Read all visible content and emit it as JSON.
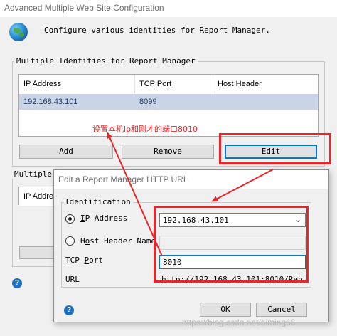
{
  "main_window": {
    "title": "Advanced Multiple Web Site Configuration",
    "description": "Configure various identities for Report Manager.",
    "identities_group": {
      "label": "Multiple Identities for Report Manager",
      "columns": [
        "IP Address",
        "TCP Port",
        "Host Header"
      ],
      "rows": [
        {
          "ip": "192.168.43.101",
          "port": "8099",
          "host": ""
        }
      ],
      "buttons": {
        "add": "Add",
        "remove": "Remove",
        "edit": "Edit"
      }
    },
    "second_group": {
      "label": "Multiple",
      "column_partial": "IP Addre"
    }
  },
  "dialog": {
    "title": "Edit a Report Manager HTTP URL",
    "identification_label": "Identification",
    "ip_address_label": "IP Address",
    "ip_address_accel": "I",
    "ip_address_rest": "P Address",
    "ip_address_value": "192.168.43.101",
    "host_header_label": "Host Header Name",
    "host_header_accel": "o",
    "host_header_pre": "H",
    "host_header_rest": "st Header Name",
    "host_header_value": "",
    "tcp_port_label": "TCP Port",
    "tcp_port_pre": "TCP ",
    "tcp_port_accel": "P",
    "tcp_port_rest": "ort",
    "tcp_port_value": "8010",
    "url_label": "URL",
    "url_value": "http://192.168.43.101:8010/Rep…",
    "ok_label": "OK",
    "cancel_label": "Cancel",
    "cancel_accel": "C",
    "cancel_rest": "ancel"
  },
  "annotation": {
    "text": "设置本机ip和刚才的端口8010",
    "color": "#e8262a"
  },
  "watermark": "https://blog.csdn.net/aiming66",
  "colors": {
    "selected_row": "#c9d5e6",
    "focus_blue": "#0078d7",
    "annotation_red": "#e8262a"
  }
}
